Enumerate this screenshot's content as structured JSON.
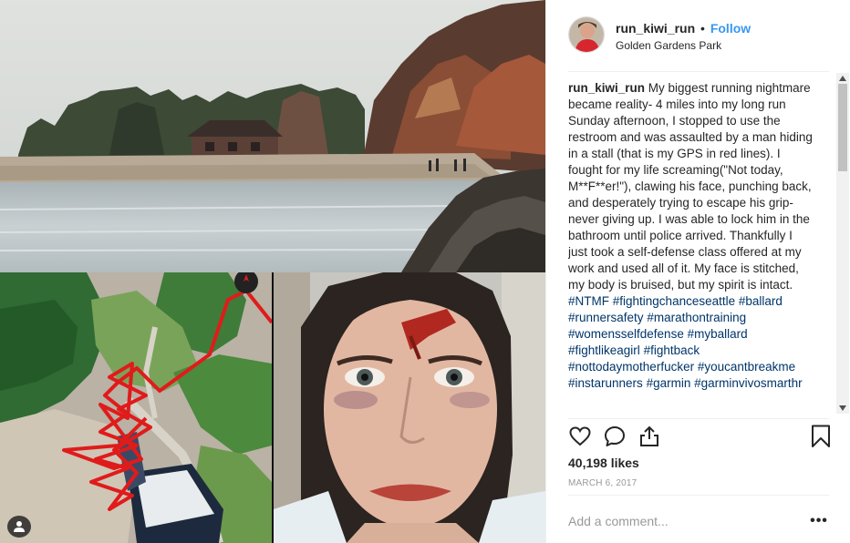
{
  "post": {
    "username": "run_kiwi_run",
    "separator": "•",
    "follow_label": "Follow",
    "location": "Golden Gardens Park"
  },
  "caption": {
    "username": "run_kiwi_run",
    "text": "My biggest running nightmare became reality- 4 miles into my long run Sunday afternoon, I stopped to use the restroom and was assaulted by a man hiding in a stall (that is my GPS in red lines). I fought for my life screaming(\"Not today, M**F**er!\"), clawing his face, punching back, and desperately trying to escape his grip- never giving up. I was able to lock him in the bathroom until police arrived. Thankfully I just took a self-defense class offered at my work and used all of it. My face is stitched, my body is bruised, but my spirit is intact.",
    "hashtags": [
      "#NTMF",
      "#fightingchanceseattle",
      "#ballard",
      "#runnersafety",
      "#marathontraining",
      "#womensselfdefense",
      "#myballard",
      "#fightlikeagirl",
      "#fightback",
      "#nottodaymotherfucker",
      "#youcantbreakme",
      "#instarunners",
      "#garmin",
      "#garminvivosmarthr"
    ]
  },
  "likes_text": "40,198 likes",
  "date": "MARCH 6, 2017",
  "comment": {
    "placeholder": "Add a comment...",
    "more_label": "•••"
  },
  "icons": {
    "like": "heart-icon",
    "comment": "speech-bubble-icon",
    "share": "share-icon",
    "save": "bookmark-icon",
    "tag_users": "person-tag-icon"
  },
  "colors": {
    "follow": "#3897f0",
    "hashtag": "#003569",
    "meta": "#999999",
    "text": "#262626",
    "gps_track": "#e01b1b"
  }
}
